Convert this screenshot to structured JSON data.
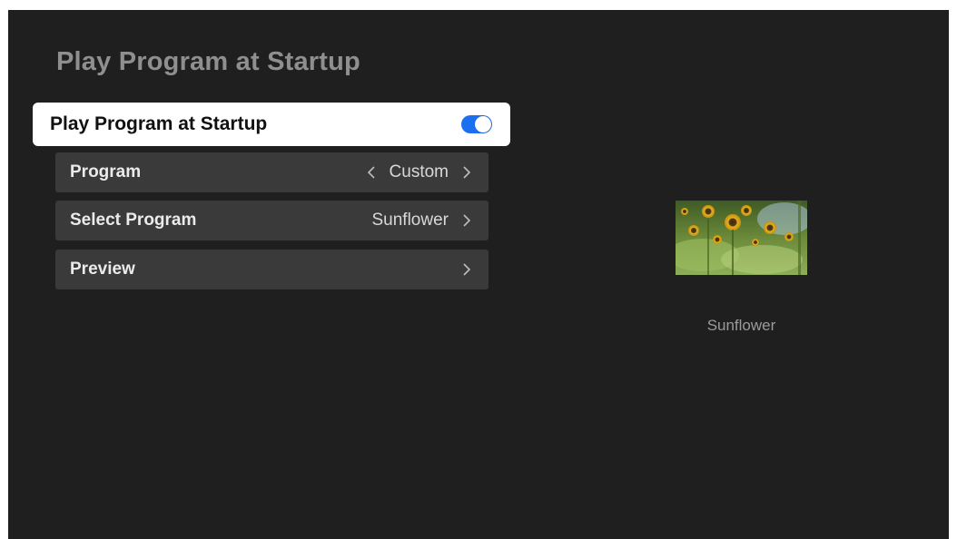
{
  "page": {
    "title": "Play Program at Startup"
  },
  "startup_toggle": {
    "label": "Play Program at Startup",
    "enabled": true,
    "accent_color": "#1d6ff2"
  },
  "settings": {
    "program": {
      "label": "Program",
      "value": "Custom",
      "left_icon": "chevron-left-icon",
      "right_icon": "chevron-right-icon"
    },
    "select_program": {
      "label": "Select Program",
      "value": "Sunflower",
      "right_icon": "chevron-right-icon"
    },
    "preview": {
      "label": "Preview",
      "right_icon": "chevron-right-icon"
    }
  },
  "preview_panel": {
    "thumbnail": "sunflower-field-image",
    "caption": "Sunflower"
  }
}
